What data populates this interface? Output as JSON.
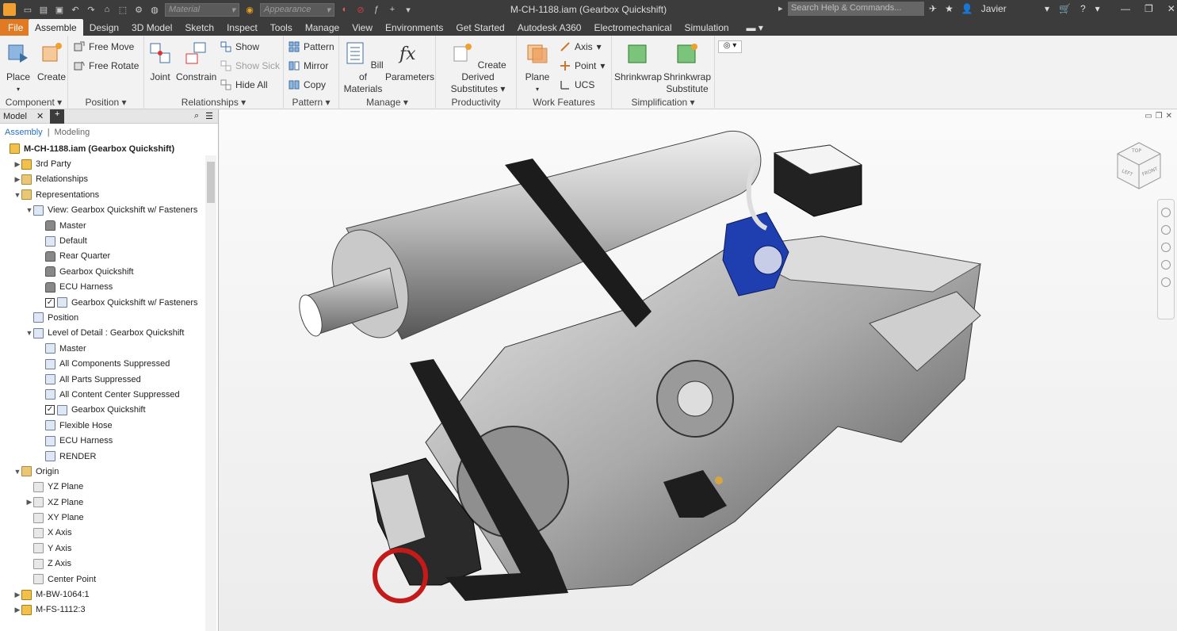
{
  "titlebar": {
    "title": "M-CH-1188.iam (Gearbox Quickshift)",
    "material_placeholder": "Material",
    "appearance_placeholder": "Appearance",
    "search_placeholder": "Search Help & Commands...",
    "user": "Javier"
  },
  "tabs": [
    "File",
    "Assemble",
    "Design",
    "3D Model",
    "Sketch",
    "Inspect",
    "Tools",
    "Manage",
    "View",
    "Environments",
    "Get Started",
    "Autodesk A360",
    "Electromechanical",
    "Simulation"
  ],
  "active_tab": "Assemble",
  "ribbon": {
    "component": {
      "title": "Component",
      "place": "Place",
      "create": "Create"
    },
    "position": {
      "title": "Position",
      "free_move": "Free Move",
      "free_rotate": "Free Rotate"
    },
    "relationships": {
      "title": "Relationships",
      "joint": "Joint",
      "constrain": "Constrain",
      "show": "Show",
      "show_sick": "Show Sick",
      "hide_all": "Hide All"
    },
    "pattern": {
      "title": "Pattern",
      "pattern": "Pattern",
      "mirror": "Mirror",
      "copy": "Copy"
    },
    "manage": {
      "title": "Manage",
      "bom_1": "Bill of",
      "bom_2": "Materials",
      "parameters": "Parameters"
    },
    "productivity": {
      "title": "Productivity",
      "cds_1": "Create Derived",
      "cds_2": "Substitutes"
    },
    "work_features": {
      "title": "Work Features",
      "plane": "Plane",
      "axis": "Axis",
      "point": "Point",
      "ucs": "UCS"
    },
    "simplification": {
      "title": "Simplification",
      "shrinkwrap": "Shrinkwrap",
      "sws_1": "Shrinkwrap",
      "sws_2": "Substitute"
    }
  },
  "browser": {
    "tab": "Model",
    "sub_assembly": "Assembly",
    "sub_modeling": "Modeling",
    "items": [
      {
        "label": "M-CH-1188.iam (Gearbox Quickshift)",
        "indent": 0,
        "icon": "asm",
        "twisty": "",
        "bold": true
      },
      {
        "label": "3rd Party",
        "indent": 1,
        "icon": "asm",
        "twisty": "▶"
      },
      {
        "label": "Relationships",
        "indent": 1,
        "icon": "fold",
        "twisty": "▶"
      },
      {
        "label": "Representations",
        "indent": 1,
        "icon": "fold",
        "twisty": "▼"
      },
      {
        "label": "View: Gearbox Quickshift w/ Fasteners",
        "indent": 2,
        "icon": "view",
        "twisty": "▼"
      },
      {
        "label": "Master",
        "indent": 3,
        "icon": "lock",
        "twisty": ""
      },
      {
        "label": "Default",
        "indent": 3,
        "icon": "view",
        "twisty": ""
      },
      {
        "label": "Rear Quarter",
        "indent": 3,
        "icon": "lock",
        "twisty": ""
      },
      {
        "label": "Gearbox Quickshift",
        "indent": 3,
        "icon": "lock",
        "twisty": ""
      },
      {
        "label": "ECU Harness",
        "indent": 3,
        "icon": "lock",
        "twisty": ""
      },
      {
        "label": "Gearbox Quickshift w/ Fasteners",
        "indent": 3,
        "icon": "view",
        "twisty": "",
        "check": true
      },
      {
        "label": "Position",
        "indent": 2,
        "icon": "view",
        "twisty": ""
      },
      {
        "label": "Level of Detail : Gearbox Quickshift",
        "indent": 2,
        "icon": "view",
        "twisty": "▼"
      },
      {
        "label": "Master",
        "indent": 3,
        "icon": "view",
        "twisty": ""
      },
      {
        "label": "All Components Suppressed",
        "indent": 3,
        "icon": "view",
        "twisty": ""
      },
      {
        "label": "All Parts Suppressed",
        "indent": 3,
        "icon": "view",
        "twisty": ""
      },
      {
        "label": "All Content Center Suppressed",
        "indent": 3,
        "icon": "view",
        "twisty": ""
      },
      {
        "label": "Gearbox Quickshift",
        "indent": 3,
        "icon": "view",
        "twisty": "",
        "check": true
      },
      {
        "label": "Flexible Hose",
        "indent": 3,
        "icon": "view",
        "twisty": ""
      },
      {
        "label": "ECU Harness",
        "indent": 3,
        "icon": "view",
        "twisty": ""
      },
      {
        "label": "RENDER",
        "indent": 3,
        "icon": "view",
        "twisty": ""
      },
      {
        "label": "Origin",
        "indent": 1,
        "icon": "fold",
        "twisty": "▼"
      },
      {
        "label": "YZ Plane",
        "indent": 2,
        "icon": "plane",
        "twisty": ""
      },
      {
        "label": "XZ Plane",
        "indent": 2,
        "icon": "plane",
        "twisty": "▶"
      },
      {
        "label": "XY Plane",
        "indent": 2,
        "icon": "plane",
        "twisty": ""
      },
      {
        "label": "X Axis",
        "indent": 2,
        "icon": "plane",
        "twisty": ""
      },
      {
        "label": "Y Axis",
        "indent": 2,
        "icon": "plane",
        "twisty": ""
      },
      {
        "label": "Z Axis",
        "indent": 2,
        "icon": "plane",
        "twisty": ""
      },
      {
        "label": "Center Point",
        "indent": 2,
        "icon": "plane",
        "twisty": ""
      },
      {
        "label": "M-BW-1064:1",
        "indent": 1,
        "icon": "asm",
        "twisty": "▶"
      },
      {
        "label": "M-FS-1112:3",
        "indent": 1,
        "icon": "asm",
        "twisty": "▶"
      }
    ]
  },
  "viewcube": {
    "top": "TOP",
    "left": "LEFT",
    "front": "FRONT"
  },
  "colors": {
    "accent": "#e07b23",
    "titlebar": "#3c3c3c",
    "ribbon": "#f2f2f2",
    "selection_blue": "#1f3fb0"
  }
}
